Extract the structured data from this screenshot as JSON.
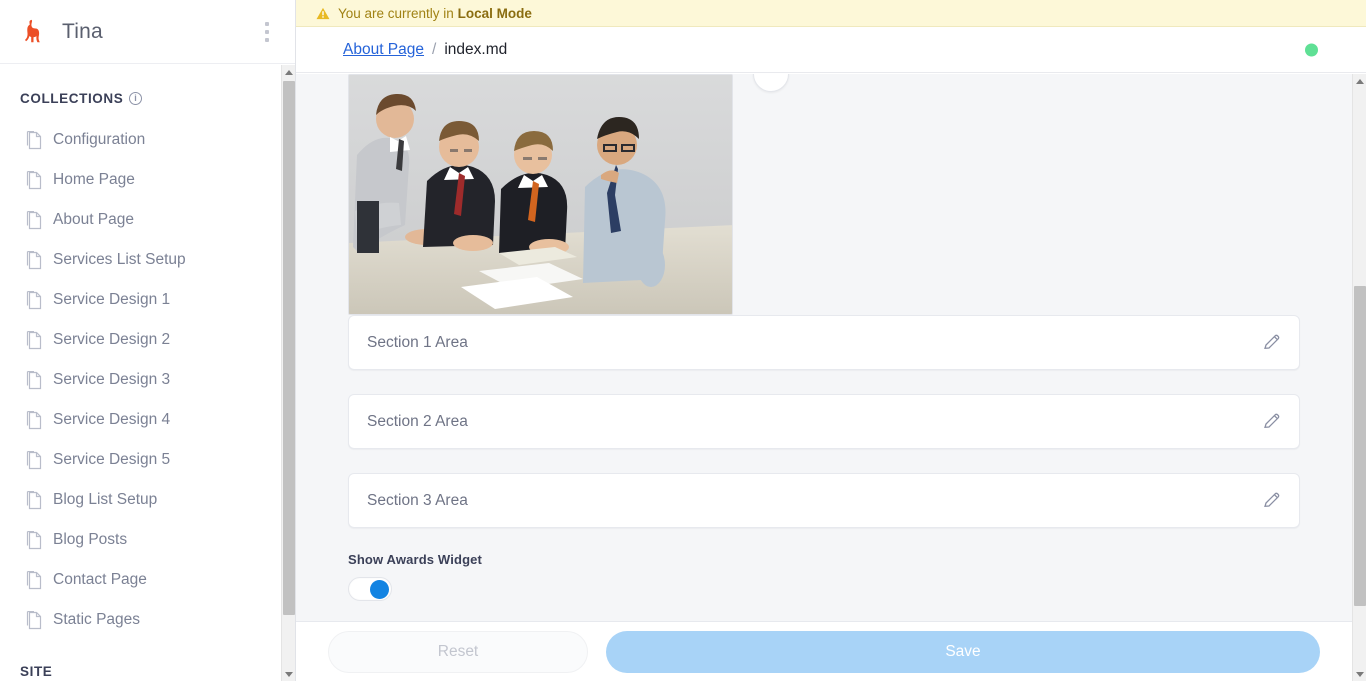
{
  "sidebar": {
    "brand": "Tina",
    "logo_icon": "llama-logo-icon",
    "logo_color": "#ec4f27",
    "menu_icon": "kebab-menu-icon",
    "collections_header": "COLLECTIONS",
    "collections_info_icon": "info-icon",
    "items": [
      {
        "label": "Configuration",
        "icon": "file-icon"
      },
      {
        "label": "Home Page",
        "icon": "file-icon"
      },
      {
        "label": "About Page",
        "icon": "file-icon"
      },
      {
        "label": "Services List Setup",
        "icon": "file-icon"
      },
      {
        "label": "Service Design 1",
        "icon": "file-icon"
      },
      {
        "label": "Service Design 2",
        "icon": "file-icon"
      },
      {
        "label": "Service Design 3",
        "icon": "file-icon"
      },
      {
        "label": "Service Design 4",
        "icon": "file-icon"
      },
      {
        "label": "Service Design 5",
        "icon": "file-icon"
      },
      {
        "label": "Blog List Setup",
        "icon": "file-icon"
      },
      {
        "label": "Blog Posts",
        "icon": "file-icon"
      },
      {
        "label": "Contact Page",
        "icon": "file-icon"
      },
      {
        "label": "Static Pages",
        "icon": "file-icon"
      }
    ],
    "site_header": "SITE"
  },
  "banner": {
    "icon": "warning-triangle-icon",
    "text_prefix": "You are currently in ",
    "mode": "Local Mode",
    "background": "#fdf8d8",
    "text_color": "#a08214"
  },
  "breadcrumb": {
    "parent": "About Page",
    "separator": "/",
    "current": "index.md",
    "link_color": "#2563d9",
    "status_indicator": "online",
    "status_color": "#5fe095"
  },
  "form": {
    "hero_image_alt": "Four businessmen in suits reviewing documents at a table",
    "hero_circle_button_icon": "circle-button",
    "sections": [
      {
        "label": "Section 1 Area",
        "edit_icon": "pencil-icon"
      },
      {
        "label": "Section 2 Area",
        "edit_icon": "pencil-icon"
      },
      {
        "label": "Section 3 Area",
        "edit_icon": "pencil-icon"
      }
    ],
    "toggle": {
      "label": "Show Awards Widget",
      "value": "on",
      "accent_color": "#1283e2"
    }
  },
  "footer": {
    "reset_label": "Reset",
    "save_label": "Save",
    "save_color": "#a8d3f7"
  }
}
